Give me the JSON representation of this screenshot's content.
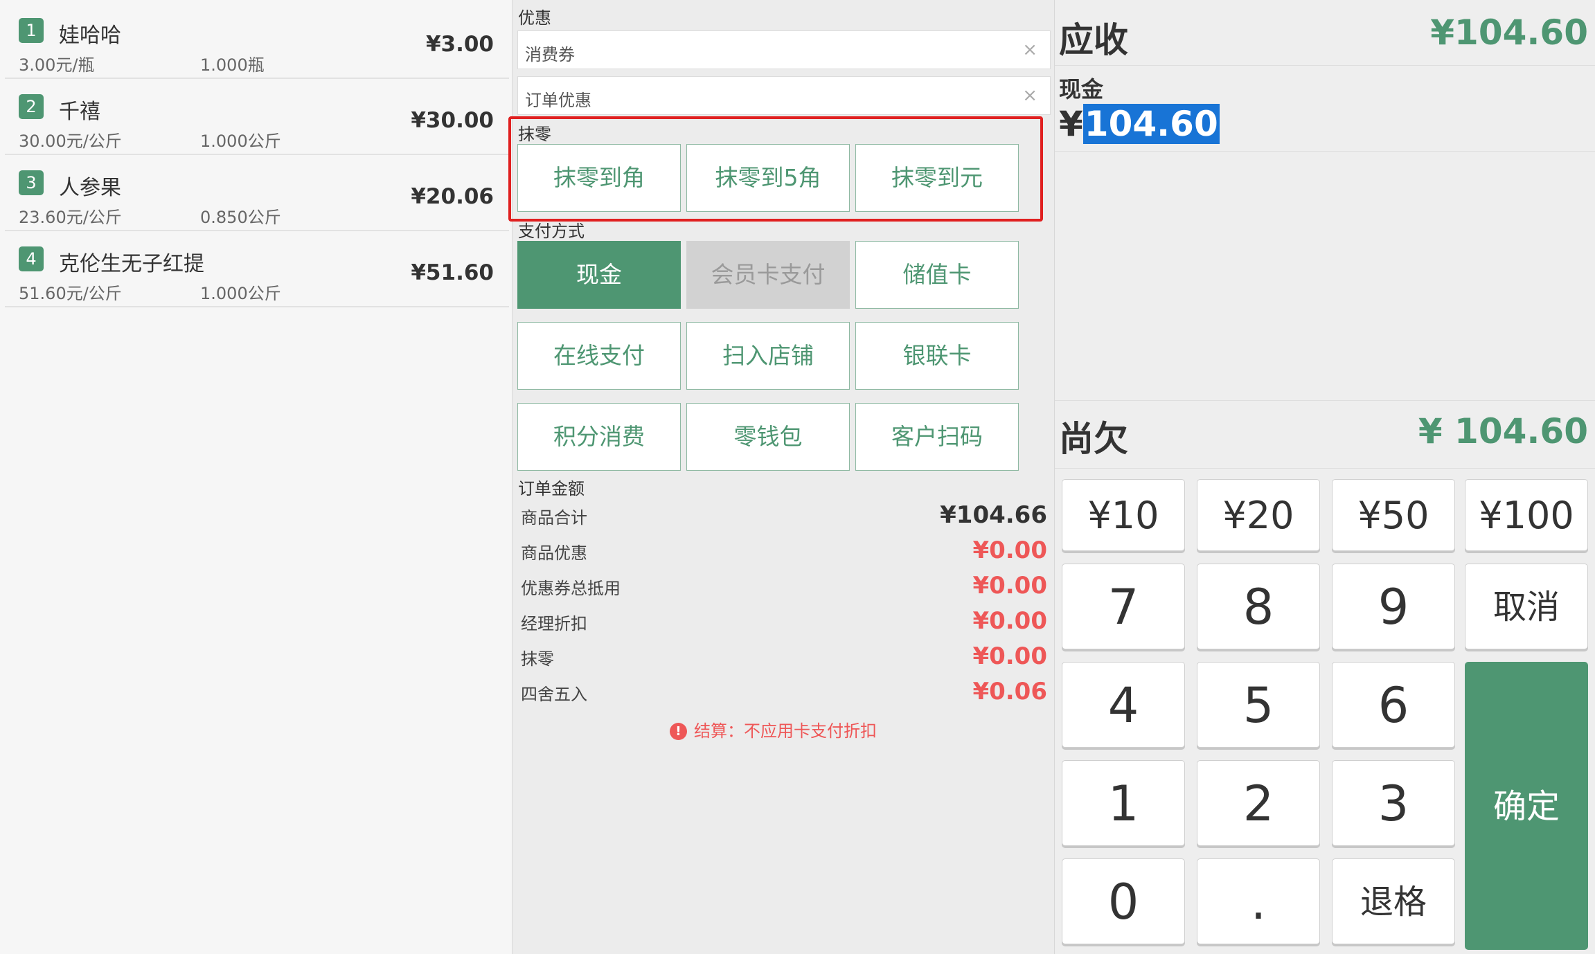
{
  "cart": {
    "items": [
      {
        "index": "1",
        "name": "娃哈哈",
        "unit_price": "3.00元/瓶",
        "quantity": "1.000瓶",
        "subtotal": "¥3.00"
      },
      {
        "index": "2",
        "name": "千禧",
        "unit_price": "30.00元/公斤",
        "quantity": "1.000公斤",
        "subtotal": "¥30.00"
      },
      {
        "index": "3",
        "name": "人参果",
        "unit_price": "23.60元/公斤",
        "quantity": "0.850公斤",
        "subtotal": "¥20.06"
      },
      {
        "index": "4",
        "name": "克伦生无子红提",
        "unit_price": "51.60元/公斤",
        "quantity": "1.000公斤",
        "subtotal": "¥51.60"
      }
    ]
  },
  "discounts": {
    "title": "优惠",
    "coupon": {
      "label": "消费券",
      "clear": "×"
    },
    "order_discount": {
      "label": "订单优惠",
      "clear": "×"
    }
  },
  "rounding": {
    "title": "抹零",
    "buttons": [
      "抹零到角",
      "抹零到5角",
      "抹零到元"
    ]
  },
  "payment": {
    "title": "支付方式",
    "methods": [
      {
        "label": "现金",
        "state": "active"
      },
      {
        "label": "会员卡支付",
        "state": "disabled"
      },
      {
        "label": "储值卡",
        "state": "normal"
      },
      {
        "label": "在线支付",
        "state": "normal"
      },
      {
        "label": "扫入店铺",
        "state": "normal"
      },
      {
        "label": "银联卡",
        "state": "normal"
      },
      {
        "label": "积分消费",
        "state": "normal"
      },
      {
        "label": "零钱包",
        "state": "normal"
      },
      {
        "label": "客户扫码",
        "state": "normal"
      }
    ]
  },
  "order_amount": {
    "title": "订单金额",
    "rows": [
      {
        "label": "商品合计",
        "value": "¥104.66"
      },
      {
        "label": "商品优惠",
        "value": "¥0.00"
      },
      {
        "label": "优惠券总抵用",
        "value": "¥0.00"
      },
      {
        "label": "经理折扣",
        "value": "¥0.00"
      },
      {
        "label": "抹零",
        "value": "¥0.00"
      },
      {
        "label": "四舍五入",
        "value": "¥0.06"
      }
    ],
    "notice": "结算：不应用卡支付折扣",
    "notice_icon": "!"
  },
  "summary": {
    "receivable_label": "应收",
    "receivable_value": "¥104.60",
    "cash_label": "现金",
    "cash_currency": "¥",
    "cash_value": "104.60",
    "owed_label": "尚欠",
    "owed_value": "¥ 104.60"
  },
  "keypad": {
    "money_keys": [
      "¥10",
      "¥20",
      "¥50",
      "¥100"
    ],
    "digits": [
      "7",
      "8",
      "9",
      "4",
      "5",
      "6",
      "1",
      "2",
      "3",
      "0",
      "."
    ],
    "cancel": "取消",
    "backspace": "退格",
    "confirm": "确定"
  },
  "colors": {
    "accent": "#4e9672",
    "negative": "#ee5757",
    "highlight": "#e02020",
    "selection": "#1874d6"
  }
}
